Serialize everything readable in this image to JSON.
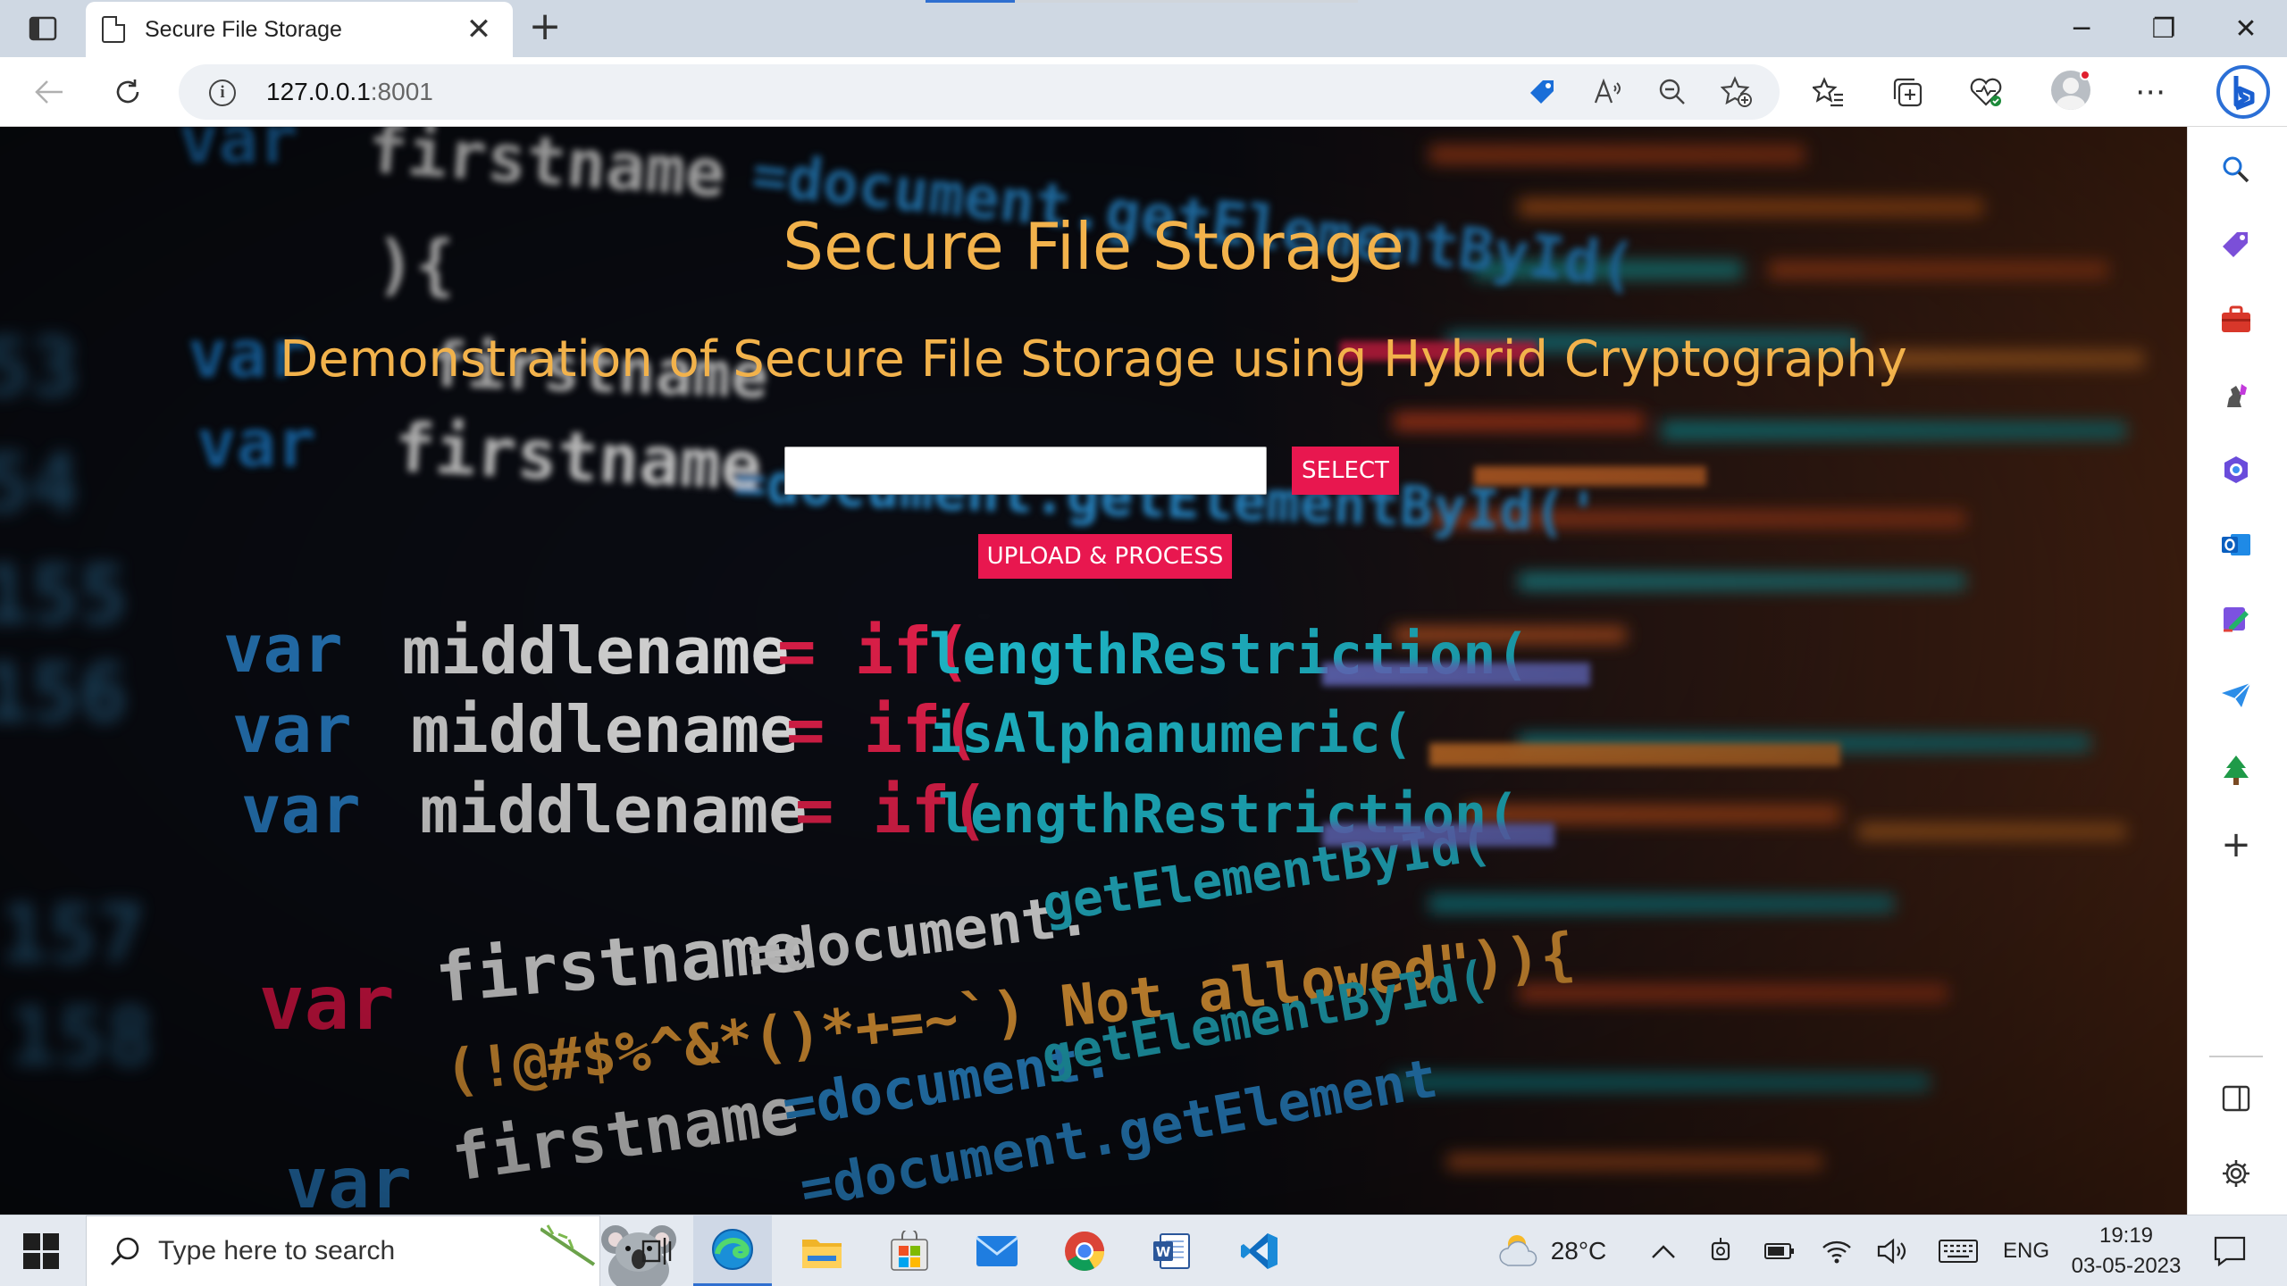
{
  "browser": {
    "tab_title": "Secure File Storage",
    "tab_close": "✕",
    "new_tab": "+",
    "url_host": "127.0.0.1",
    "url_port": ":8001",
    "window_controls": {
      "minimize": "─",
      "restore": "❐",
      "close": "✕"
    },
    "more_label": "⋯"
  },
  "page": {
    "title": "Secure File Storage",
    "subtitle": "Demonstration of Secure File Storage using Hybrid Cryptography",
    "file_input_value": "",
    "select_button": "SELECT",
    "upload_button": "UPLOAD & PROCESS",
    "accent_color": "#e8174f",
    "heading_color": "#f2b24b"
  },
  "sidebar": {
    "add_label": "+"
  },
  "taskbar": {
    "search_placeholder": "Type here to search",
    "weather_temp": "28°C",
    "language": "ENG",
    "time": "19:19",
    "date": "03-05-2023"
  }
}
